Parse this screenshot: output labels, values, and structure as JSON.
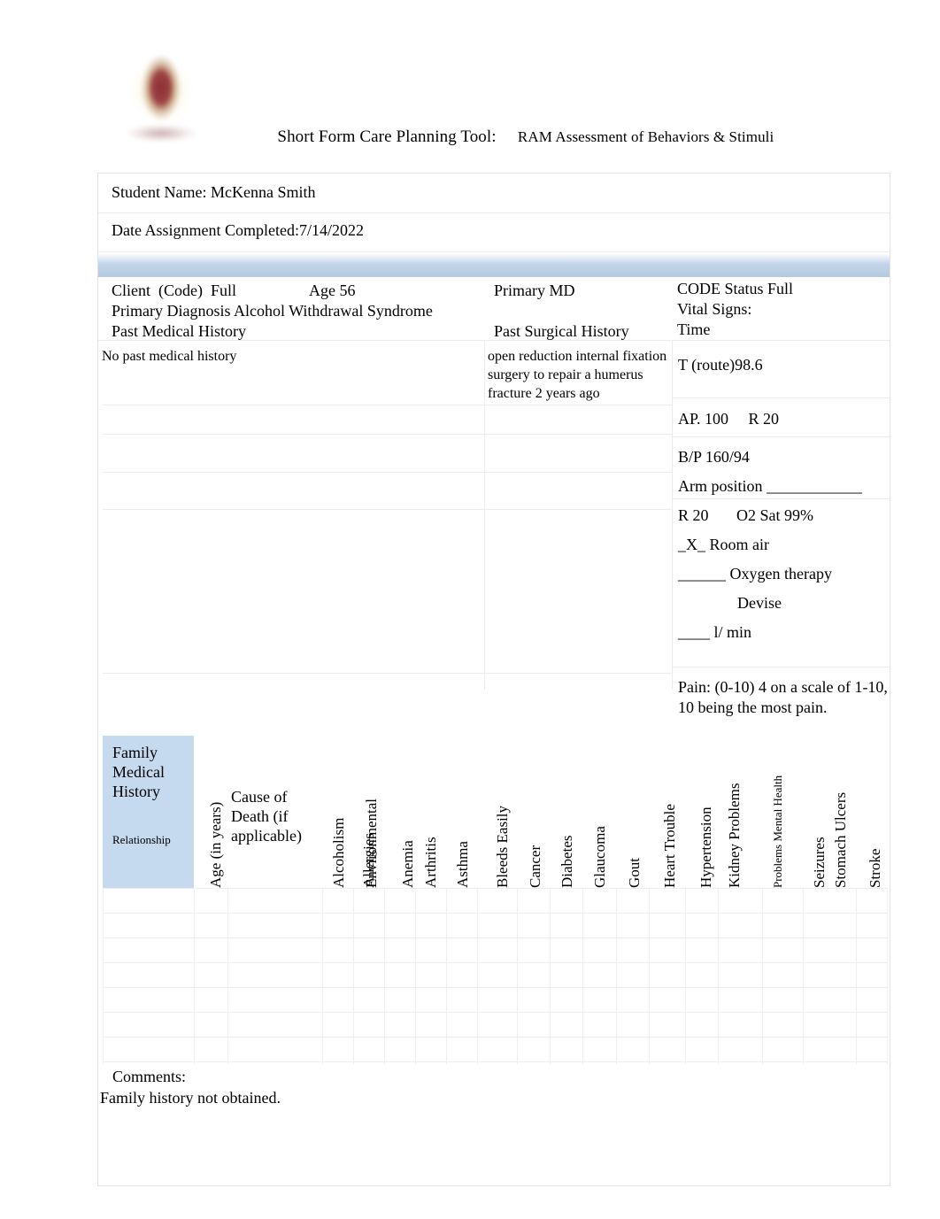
{
  "header": {
    "logo_alt": "school-crest-logo",
    "title_primary": "Short Form Care Planning Tool:",
    "title_secondary": "RAM Assessment of Behaviors & Stimuli"
  },
  "identification": {
    "student_name_label": "Student Name: McKenna Smith",
    "date_completed_label": "Date Assignment Completed:7/14/2022"
  },
  "client_info": {
    "client_code": "Client  (Code)  Full",
    "age": "Age 56",
    "primary_md": "Primary MD",
    "code_status": "CODE Status Full",
    "primary_diagnosis": "Primary Diagnosis Alcohol Withdrawal Syndrome",
    "vital_signs_label": "Vital Signs:",
    "past_medical_history_label": "Past Medical History",
    "past_surgical_history_label": "Past Surgical History",
    "time_label": "Time"
  },
  "history": {
    "past_medical_history_value": "No past medical history",
    "past_surgical_history_value": "open reduction internal fixation surgery to repair a humerus fracture 2 years ago"
  },
  "vitals": {
    "temperature": "T (route)98.6",
    "apical_respiration": "AP. 100     R 20",
    "blood_pressure": "B/P 160/94",
    "arm_position": "Arm position ____________",
    "resp_o2sat": "R 20       O2 Sat 99%",
    "room_air": "_X_ Room air",
    "oxygen_therapy": "______ Oxygen therapy",
    "devise": "Devise",
    "liters_per_min": "____ l/ min",
    "pain": "Pain: (0-10) 4 on a scale of 1-10, 10 being the most pain."
  },
  "family_history": {
    "section_title": "Family Medical History",
    "relationship_label": "Relationship",
    "cause_of_death_header": "Cause of Death (if applicable)",
    "columns": [
      {
        "label": "Age (in years)",
        "style": "normal"
      },
      {
        "label": "Alcoholism",
        "style": "normal"
      },
      {
        "label": "Allergies",
        "style": "overlap-a"
      },
      {
        "label": "Environmental",
        "style": "overlap-b"
      },
      {
        "label": "Anemia",
        "style": "normal"
      },
      {
        "label": "Arthritis",
        "style": "normal"
      },
      {
        "label": "Asthma",
        "style": "normal"
      },
      {
        "label": "Bleeds Easily",
        "style": "normal"
      },
      {
        "label": "Cancer",
        "style": "normal"
      },
      {
        "label": "Diabetes",
        "style": "normal"
      },
      {
        "label": "Glaucoma",
        "style": "normal"
      },
      {
        "label": "Gout",
        "style": "normal"
      },
      {
        "label": "Heart Trouble",
        "style": "normal"
      },
      {
        "label": "Hypertension",
        "style": "normal"
      },
      {
        "label": "Kidney Problems",
        "style": "normal"
      },
      {
        "label": "Problems Mental Health",
        "style": "small"
      },
      {
        "label": "Seizures",
        "style": "overlap-a"
      },
      {
        "label": "Stomach Ulcers",
        "style": "overlap-b"
      },
      {
        "label": "Stroke",
        "style": "normal"
      }
    ],
    "rows": [
      "",
      "",
      "",
      "",
      "",
      "",
      ""
    ]
  },
  "comments": {
    "label": "Comments:",
    "value": "Family history not obtained."
  },
  "colors": {
    "banner_blue": "#b4cade",
    "family_cell_blue": "#c5d9ef",
    "grid_line": "#ececec",
    "text": "#000000"
  }
}
